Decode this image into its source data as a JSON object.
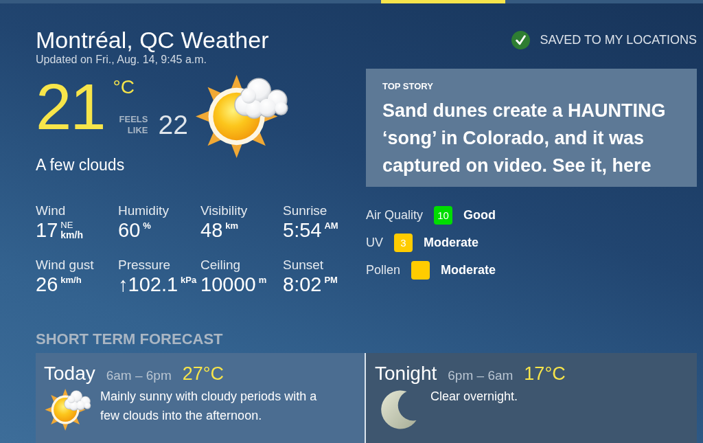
{
  "location_title": "Montréal, QC Weather",
  "updated": "Updated on Fri., Aug. 14, 9:45 a.m.",
  "saved_location": {
    "label": "SAVED TO MY LOCATIONS",
    "saved": true
  },
  "current": {
    "temperature": "21",
    "unit": "°C",
    "feels_like_label": "FEELS LIKE",
    "feels_like": "22",
    "condition": "A few clouds"
  },
  "details": [
    {
      "label": "Wind",
      "value": "17",
      "direction": "NE",
      "unit": "km/h"
    },
    {
      "label": "Humidity",
      "value": "60",
      "unit": "%"
    },
    {
      "label": "Visibility",
      "value": "48",
      "unit": "km"
    },
    {
      "label": "Sunrise",
      "value": "5:54",
      "unit": "AM"
    },
    {
      "label": "Wind gust",
      "value": "26",
      "unit": "km/h"
    },
    {
      "label": "Pressure",
      "value": "↑102.1",
      "unit": "kPa"
    },
    {
      "label": "Ceiling",
      "value": "10000",
      "unit": "m"
    },
    {
      "label": "Sunset",
      "value": "8:02",
      "unit": "PM"
    }
  ],
  "top_story": {
    "kicker": "TOP STORY",
    "headline": "Sand dunes create a HAUNTING ‘song’ in Colorado, and it was captured on video. See it, here"
  },
  "indices": [
    {
      "label": "Air Quality",
      "value": "10",
      "color": "#00dd00",
      "rating": "Good"
    },
    {
      "label": "UV",
      "value": "3",
      "color": "#ffcc00",
      "rating": "Moderate"
    },
    {
      "label": "Pollen",
      "color": "#ffcc00",
      "rating": "Moderate"
    }
  ],
  "short_term_forecast": {
    "title": "SHORT TERM FORECAST",
    "periods": [
      {
        "kind": "day",
        "name": "Today",
        "time_range": "6am – 6pm",
        "temperature": "27°C",
        "description": "Mainly sunny with cloudy periods with a few clouds into the afternoon."
      },
      {
        "kind": "night",
        "name": "Tonight",
        "time_range": "6pm – 6am",
        "temperature": "17°C",
        "description": "Clear overnight."
      }
    ]
  }
}
